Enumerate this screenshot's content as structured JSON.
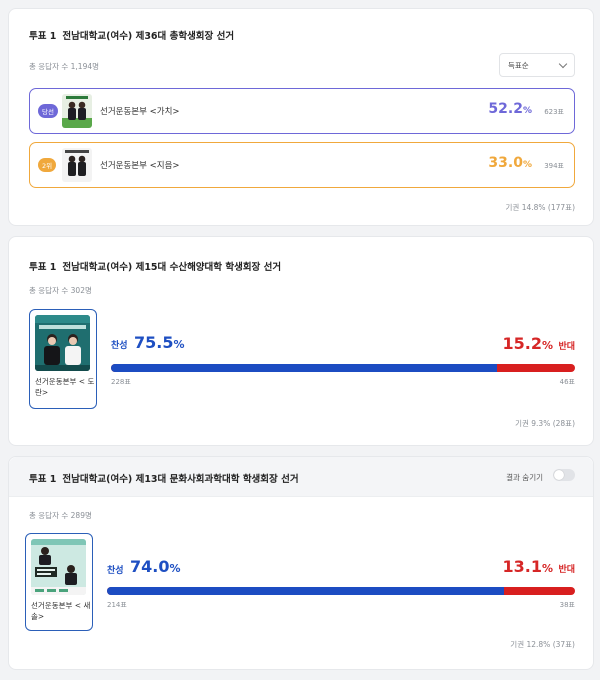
{
  "polls": [
    {
      "vote_tag": "투표 1",
      "title": "전남대학교(여수) 제36대 총학생회장 선거",
      "respondents": "총 응답자 수 1,194명",
      "sort": {
        "selected": "득표순"
      },
      "candidates": [
        {
          "badge": "당선",
          "name": "선거운동본부 <가치>",
          "pct": "52.2",
          "unit": "%",
          "votes": "623표"
        },
        {
          "badge": "2위",
          "name": "선거운동본부 <지음>",
          "pct": "33.0",
          "unit": "%",
          "votes": "394표"
        }
      ],
      "abstain": "기권 14.8% (177표)",
      "colors": {
        "winner": "#6e68d8",
        "second": "#f0a83c"
      }
    },
    {
      "vote_tag": "투표 1",
      "title": "전남대학교(여수) 제15대 수산해양대학 학생회장 선거",
      "respondents": "총 응답자 수 302명",
      "candidate_name": "선거운동본부 < 도란>",
      "yes_label": "찬성",
      "yes_pct": "75.5",
      "no_pct": "15.2",
      "unit": "%",
      "no_label": "반대",
      "yes_votes": "228표",
      "no_votes": "46표",
      "yes_fraction": 0.832,
      "abstain": "기권 9.3% (28표)",
      "colors": {
        "yes": "#1c4cc2",
        "no": "#d81f1f"
      }
    },
    {
      "vote_tag": "투표 1",
      "title": "전남대학교(여수) 제13대 문화사회과학대학 학생회장 선거",
      "hide_results_label": "결과 숨기기",
      "hide_results_on": false,
      "respondents": "총 응답자 수 289명",
      "candidate_name": "선거운동본부 < 새솔>",
      "yes_label": "찬성",
      "yes_pct": "74.0",
      "no_pct": "13.1",
      "unit": "%",
      "no_label": "반대",
      "yes_votes": "214표",
      "no_votes": "38표",
      "yes_fraction": 0.849,
      "abstain": "기권 12.8% (37표)",
      "colors": {
        "yes": "#1c4cc2",
        "no": "#d81f1f"
      }
    }
  ]
}
